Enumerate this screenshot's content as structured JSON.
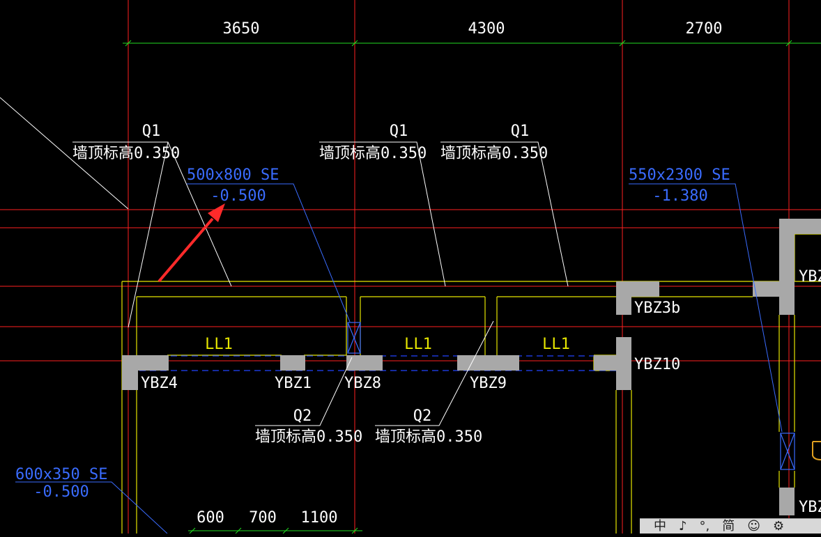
{
  "drawing": {
    "dimensions_top": [
      "3650",
      "4300",
      "2700"
    ],
    "dimensions_bottom": [
      "600",
      "700",
      "1100"
    ],
    "labels": {
      "q1": "Q1",
      "q2": "Q2",
      "wall_top": "墙顶标高0.350",
      "beam_a_size": "500x800 SE",
      "beam_a_elev": "-0.500",
      "beam_b_size": "550x2300 SE",
      "beam_b_elev": "-1.380",
      "beam_c_size": "600x350 SE",
      "beam_c_elev": "-0.500",
      "ll1": "LL1",
      "ybz4": "YBZ4",
      "ybz1": "YBZ1",
      "ybz8": "YBZ8",
      "ybz9": "YBZ9",
      "ybz3b": "YBZ3b",
      "ybz10": "YBZ10",
      "ybz_edge1": "YBZ",
      "ybz_edge2": "YBZ"
    },
    "colors": {
      "background": "#000000",
      "grid_red": "#ff2020",
      "dimension_green": "#22dd22",
      "wall_yellow": "#e6e600",
      "column_gray": "#a8a8a8",
      "annotation_blue": "#3a6cff",
      "leader_white": "#ffffff",
      "arrow_red": "#ff2a2a"
    }
  },
  "ime_toolbar": {
    "chars": [
      "中",
      "♪",
      "°,",
      "简",
      "☺",
      "⚙"
    ]
  }
}
